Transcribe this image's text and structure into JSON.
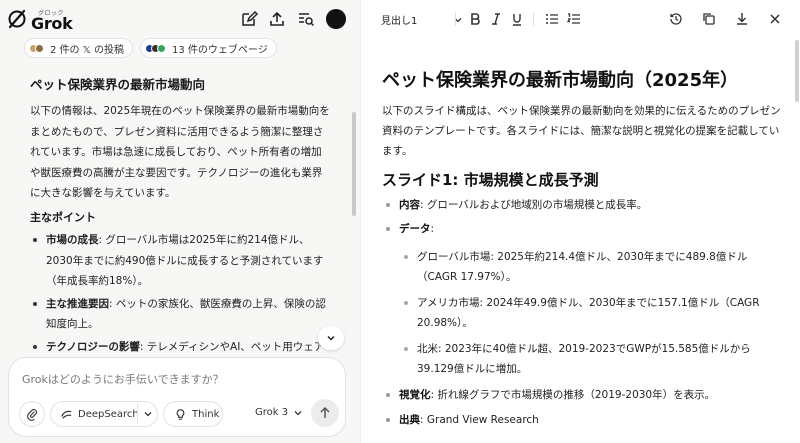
{
  "app": {
    "logo_sub": "グロック",
    "logo_word": "Grok"
  },
  "sources": {
    "x_posts": "2 件の 𝕏 の投稿",
    "web_pages": "13 件のウェブページ"
  },
  "chat": {
    "title": "ペット保険業界の最新市場動向",
    "intro": "以下の情報は、2025年現在のペット保険業界の最新市場動向をまとめたもので、プレゼン資料に活用できるよう簡潔に整理されています。市場は急速に成長しており、ペット所有者の増加や獣医療費の高騰が主な要因です。テクノロジーの進化も業界に大きな影響を与えています。",
    "points_title": "主なポイント",
    "points": [
      {
        "label": "市場の成長",
        "text": ": グローバル市場は2025年に約214億ドル、2030年までに約490億ドルに成長すると予測されています（年成長率約18%）。"
      },
      {
        "label": "主な推進要因",
        "text": ": ペットの家族化、獣医療費の上昇、保険の認知度向上。"
      },
      {
        "label": "テクノロジーの影響",
        "text": ": テレメディシンやAI、ペット用ウェアラブル技術が普及"
      }
    ]
  },
  "composer": {
    "placeholder": "Grokはどのようにお手伝いできますか？",
    "deepsearch_label": "DeepSearch",
    "think_label": "Think",
    "model_label": "Grok 3"
  },
  "editor": {
    "style_select": "見出し1"
  },
  "document": {
    "title": "ペット保険業界の最新市場動向（2025年）",
    "intro": "以下のスライド構成は、ペット保険業界の最新動向を効果的に伝えるためのプレゼン資料のテンプレートです。各スライドには、簡潔な説明と視覚化の提案を記載しています。",
    "slide1_title": "スライド1: 市場規模と成長予測",
    "content_label": "内容",
    "content_text": ": グローバルおよび地域別の市場規模と成長率。",
    "data_label": "データ",
    "data_colon": ":",
    "data_items": [
      "グローバル市場: 2025年約214.4億ドル、2030年までに489.8億ドル（CAGR 17.97%）。",
      "アメリカ市場: 2024年49.9億ドル、2030年までに157.1億ドル（CAGR 20.98%）。",
      "北米: 2023年に40億ドル超、2019-2023でGWPが15.585億ドルから39.129億ドルに増加。"
    ],
    "visual_label": "視覚化",
    "visual_text": ": 折れ線グラフで市場規模の推移（2019-2030年）を表示。",
    "source_label": "出典",
    "source_text": ": Grand View Research"
  }
}
